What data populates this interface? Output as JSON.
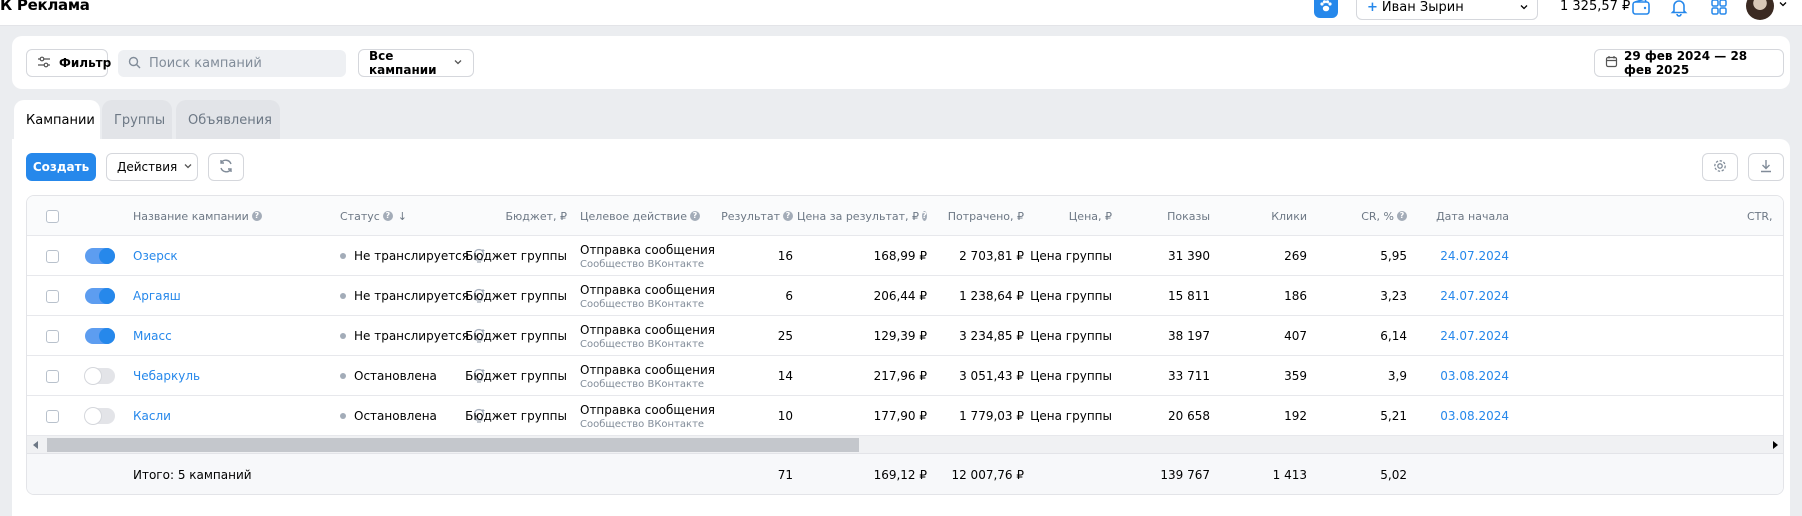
{
  "app": {
    "logo": "К Реклама"
  },
  "topbar": {
    "account_name": "Иван Зырин",
    "balance": "1 325,57 ₽"
  },
  "filter": {
    "filter_label": "Фильтр",
    "search_placeholder": "Поиск кампаний",
    "campaign_select": "Все кампании",
    "date_range": "29 фев 2024 — 28 фев 2025"
  },
  "tabs": [
    "Кампании",
    "Группы",
    "Объявления"
  ],
  "toolbar": {
    "create_label": "Создать",
    "actions_label": "Действия"
  },
  "columns": {
    "name": "Название кампании",
    "status": "Статус",
    "budget": "Бюджет, ₽",
    "target": "Целевое действие",
    "result": "Результат",
    "price_result": "Цена за результат, ₽",
    "spent": "Потрачено, ₽",
    "price": "Цена, ₽",
    "impressions": "Показы",
    "clicks": "Клики",
    "cr": "CR, %",
    "start_date": "Дата начала",
    "ctr": "CTR,"
  },
  "rows": [
    {
      "enabled": true,
      "name": "Озерск",
      "status": "Не транслируется",
      "budget": "Бюджет группы",
      "target": "Отправка сообщения",
      "target_sub": "Сообщество ВКонтакте",
      "result": "16",
      "price_result": "168,99 ₽",
      "spent": "2 703,81 ₽",
      "price": "Цена группы",
      "impressions": "31 390",
      "clicks": "269",
      "cr": "5,95",
      "start_date": "24.07.2024"
    },
    {
      "enabled": true,
      "name": "Аргаяш",
      "status": "Не транслируется",
      "budget": "Бюджет группы",
      "target": "Отправка сообщения",
      "target_sub": "Сообщество ВКонтакте",
      "result": "6",
      "price_result": "206,44 ₽",
      "spent": "1 238,64 ₽",
      "price": "Цена группы",
      "impressions": "15 811",
      "clicks": "186",
      "cr": "3,23",
      "start_date": "24.07.2024"
    },
    {
      "enabled": true,
      "name": "Миасс",
      "status": "Не транслируется",
      "budget": "Бюджет группы",
      "target": "Отправка сообщения",
      "target_sub": "Сообщество ВКонтакте",
      "result": "25",
      "price_result": "129,39 ₽",
      "spent": "3 234,85 ₽",
      "price": "Цена группы",
      "impressions": "38 197",
      "clicks": "407",
      "cr": "6,14",
      "start_date": "24.07.2024"
    },
    {
      "enabled": false,
      "name": "Чебаркуль",
      "status": "Остановлена",
      "budget": "Бюджет группы",
      "target": "Отправка сообщения",
      "target_sub": "Сообщество ВКонтакте",
      "result": "14",
      "price_result": "217,96 ₽",
      "spent": "3 051,43 ₽",
      "price": "Цена группы",
      "impressions": "33 711",
      "clicks": "359",
      "cr": "3,9",
      "start_date": "03.08.2024"
    },
    {
      "enabled": false,
      "name": "Касли",
      "status": "Остановлена",
      "budget": "Бюджет группы",
      "target": "Отправка сообщения",
      "target_sub": "Сообщество ВКонтакте",
      "result": "10",
      "price_result": "177,90 ₽",
      "spent": "1 779,03 ₽",
      "price": "Цена группы",
      "impressions": "20 658",
      "clicks": "192",
      "cr": "5,21",
      "start_date": "03.08.2024"
    }
  ],
  "totals": {
    "label": "Итого: 5 кампаний",
    "result": "71",
    "price_result": "169,12 ₽",
    "spent": "12 007,76 ₽",
    "impressions": "139 767",
    "clicks": "1 413",
    "cr": "5,02"
  },
  "colors": {
    "accent": "#2688eb",
    "toggle_on_track": "#5d9df0",
    "status_dot": "#a3acb8"
  }
}
